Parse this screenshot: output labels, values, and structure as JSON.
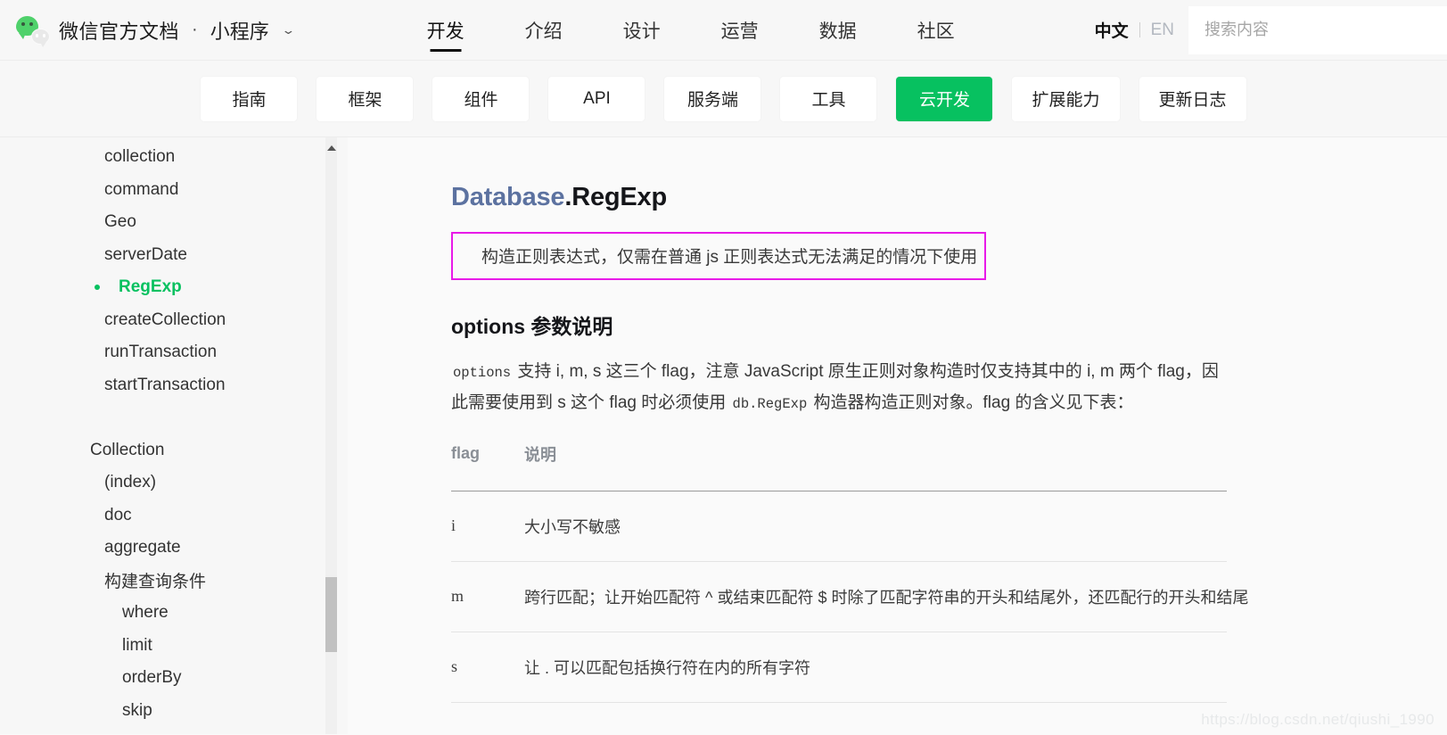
{
  "header": {
    "logo_icon": "wechat-logo-icon",
    "brand_title": "微信官方文档",
    "brand_separator": "·",
    "brand_sub": "小程序",
    "brand_caret_icon": "chevron-down-icon",
    "nav": [
      {
        "label": "开发",
        "active": true
      },
      {
        "label": "介绍",
        "active": false
      },
      {
        "label": "设计",
        "active": false
      },
      {
        "label": "运营",
        "active": false
      },
      {
        "label": "数据",
        "active": false
      },
      {
        "label": "社区",
        "active": false
      }
    ],
    "lang": {
      "cn": "中文",
      "en": "EN",
      "active": "中文"
    },
    "search": {
      "value": "",
      "placeholder": "搜索内容",
      "icon": "search-icon"
    }
  },
  "subnav": {
    "tabs": [
      {
        "label": "指南",
        "active": false
      },
      {
        "label": "框架",
        "active": false
      },
      {
        "label": "组件",
        "active": false
      },
      {
        "label": "API",
        "active": false
      },
      {
        "label": "服务端",
        "active": false
      },
      {
        "label": "工具",
        "active": false
      },
      {
        "label": "云开发",
        "active": true
      },
      {
        "label": "扩展能力",
        "active": false
      },
      {
        "label": "更新日志",
        "active": false
      }
    ],
    "active_color": "#07c160"
  },
  "sidebar": {
    "items": [
      {
        "label": "collection",
        "level": 1,
        "active": false
      },
      {
        "label": "command",
        "level": 1,
        "active": false
      },
      {
        "label": "Geo",
        "level": 1,
        "active": false
      },
      {
        "label": "serverDate",
        "level": 1,
        "active": false
      },
      {
        "label": "RegExp",
        "level": 1,
        "active": true
      },
      {
        "label": "createCollection",
        "level": 1,
        "active": false
      },
      {
        "label": "runTransaction",
        "level": 1,
        "active": false
      },
      {
        "label": "startTransaction",
        "level": 1,
        "active": false
      },
      {
        "label": "",
        "level": 0,
        "active": false
      },
      {
        "label": "Collection",
        "level": 0,
        "active": false
      },
      {
        "label": "(index)",
        "level": 1,
        "active": false
      },
      {
        "label": "doc",
        "level": 1,
        "active": false
      },
      {
        "label": "aggregate",
        "level": 1,
        "active": false
      },
      {
        "label": "构建查询条件",
        "level": 1,
        "active": false
      },
      {
        "label": "where",
        "level": 2,
        "active": false
      },
      {
        "label": "limit",
        "level": 2,
        "active": false
      },
      {
        "label": "orderBy",
        "level": 2,
        "active": false
      },
      {
        "label": "skip",
        "level": 2,
        "active": false
      }
    ],
    "scrollbar": {
      "up_arrow_icon": "triangle-up-icon"
    },
    "active_color": "#07c160"
  },
  "main": {
    "title_namespace": "Database",
    "title_member": ".RegExp",
    "highlight": {
      "text": "构造正则表达式，仅需在普通 js 正则表达式无法满足的情况下使用",
      "border_color": "#e81ae8"
    },
    "section_title": "options 参数说明",
    "paragraph": {
      "code1": "options",
      "part1": " 支持 i, m, s 这三个 flag，注意 JavaScript 原生正则对象构造时仅支持其中的 i, m 两个 flag，因此需要使用到 s 这个 flag 时必须使用 ",
      "code2": "db.RegExp",
      "part2": " 构造器构造正则对象。flag 的含义见下表："
    },
    "table": {
      "headers": [
        "flag",
        "说明"
      ],
      "rows": [
        {
          "flag": "i",
          "desc": "大小写不敏感"
        },
        {
          "flag": "m",
          "desc": "跨行匹配；让开始匹配符 ^ 或结束匹配符 $ 时除了匹配字符串的开头和结尾外，还匹配行的开头和结尾"
        },
        {
          "flag": "s",
          "desc": "让 . 可以匹配包括换行符在内的所有字符"
        }
      ]
    },
    "watermark": "https://blog.csdn.net/qiushi_1990"
  }
}
